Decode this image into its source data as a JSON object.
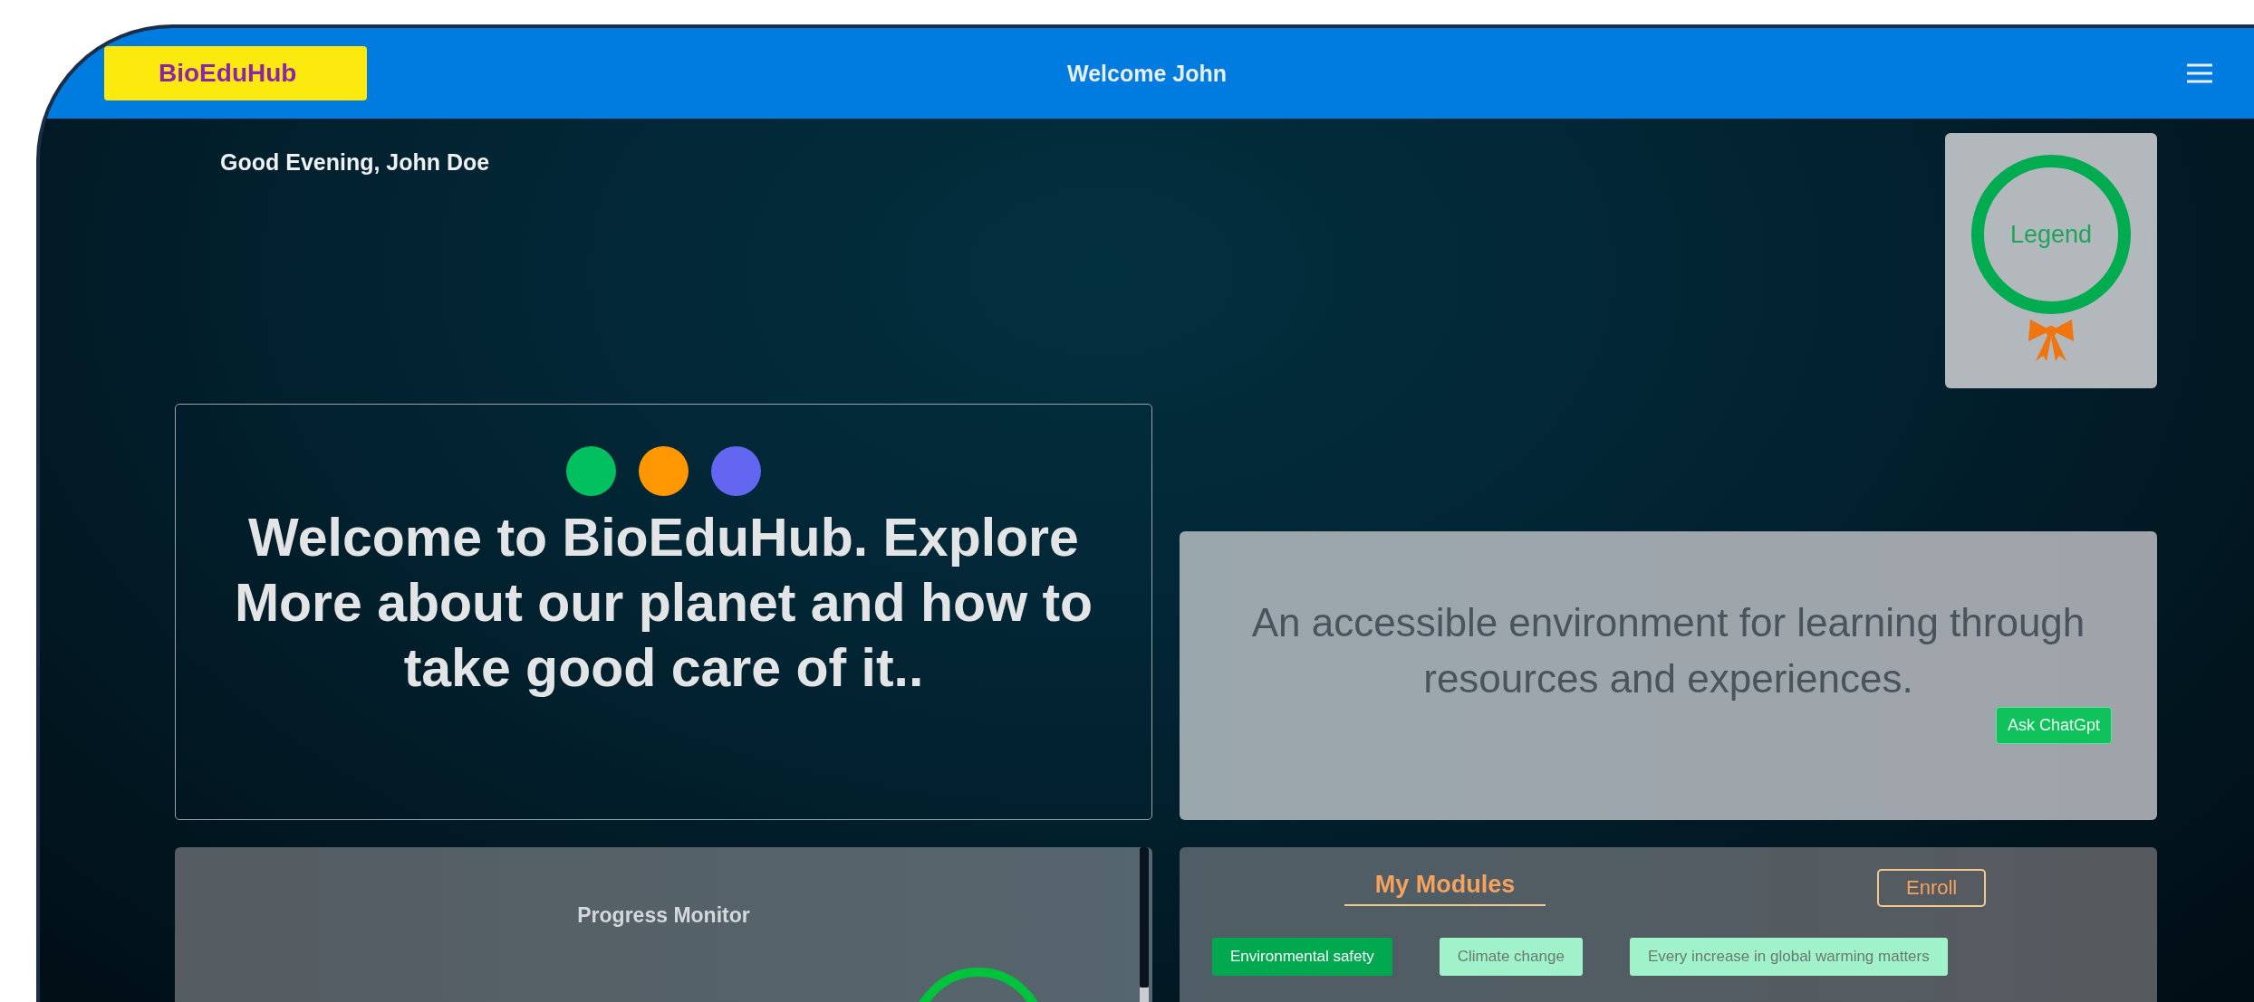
{
  "nav": {
    "logo": "BioEduHub",
    "title": "Welcome John"
  },
  "greeting": "Good Evening, John Doe",
  "badge": {
    "label": "Legend"
  },
  "welcome": {
    "dots": [
      {
        "color": "#00c060"
      },
      {
        "color": "#ff9800"
      },
      {
        "color": "#6366f1"
      }
    ],
    "heading": "Welcome to BioEduHub. Explore More about our planet and how to take good care of it.."
  },
  "info": {
    "text": "An accessible environment for learning through resources and experiences.",
    "button": "Ask ChatGpt"
  },
  "progress": {
    "title": "Progress Monitor"
  },
  "modules": {
    "title": "My Modules",
    "button": "Enroll",
    "items": [
      {
        "label": "Environmental safety",
        "selected": true
      },
      {
        "label": "Climate change",
        "selected": false
      },
      {
        "label": "Every increase in global warming matters",
        "selected": false
      }
    ]
  }
}
